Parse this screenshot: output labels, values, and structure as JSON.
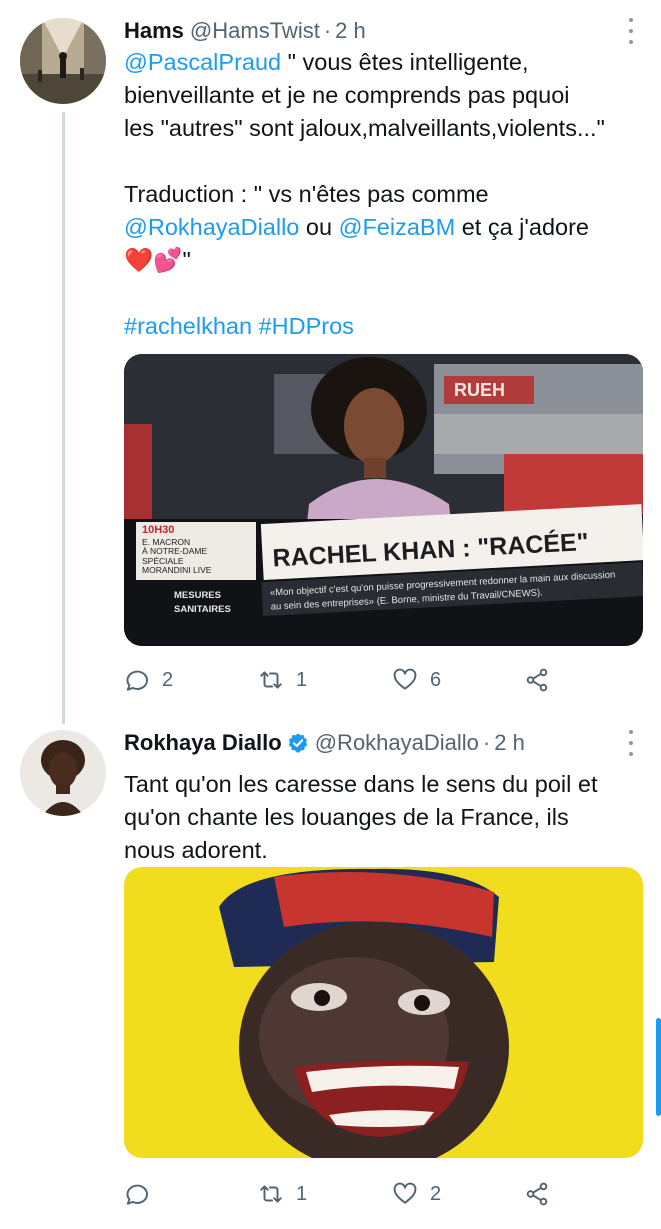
{
  "tweets": [
    {
      "name": "Hams",
      "handle": "@HamsTwist",
      "separator": "·",
      "time": "2 h",
      "verified": false,
      "lines": [
        {
          "mention": "@PascalPraud",
          "rest": " \" vous êtes intelligente,"
        },
        {
          "text": "bienveillante et je ne comprends pas pquoi"
        },
        {
          "text": "les \"autres\" sont jaloux,malveillants,violents...\""
        },
        {
          "text": "Traduction : \" vs n'êtes pas comme"
        },
        {
          "mention": "@RokhayaDiallo",
          "middle": " ou ",
          "mention2": "@FeizaBM",
          "rest": " et ça j'adore"
        },
        {
          "emoji": "❤️💕",
          "rest": "\""
        }
      ],
      "hashtags": [
        "#rachelkhan",
        "#HDPros"
      ],
      "media": {
        "banner_time": "10H30",
        "banner_lines": [
          "E. MACRON",
          "À NOTRE-DAME",
          "SPÉCIALE",
          "MORANDINI LIVE"
        ],
        "side_lines": [
          "MESURES",
          "SANITAIRES"
        ],
        "headline": "RACHEL KHAN : \"RACÉE\"",
        "subtitle_1": "«Mon objectif c'est qu'on puisse progressivement redonner la main aux discussion",
        "subtitle_2": "au sein des entreprises» (E. Borne, ministre du Travail/CNEWS)."
      },
      "actions": {
        "reply": "2",
        "retweet": "1",
        "like": "6"
      }
    },
    {
      "name": "Rokhaya Diallo",
      "handle": "@RokhayaDiallo",
      "separator": "·",
      "time": "2 h",
      "verified": true,
      "lines": [
        {
          "text": "Tant qu'on les caresse dans le sens du poil et"
        },
        {
          "text": "qu'on chante les louanges de la France, ils"
        },
        {
          "text": "nous adorent."
        }
      ],
      "actions": {
        "reply": "",
        "retweet": "1",
        "like": "2"
      }
    }
  ],
  "colors": {
    "accent": "#1d9bf0",
    "muted": "#536471",
    "poster_yellow": "#f2dc1e"
  },
  "icons": [
    "more-icon",
    "verified-icon",
    "reply-icon",
    "retweet-icon",
    "like-icon",
    "share-icon"
  ]
}
